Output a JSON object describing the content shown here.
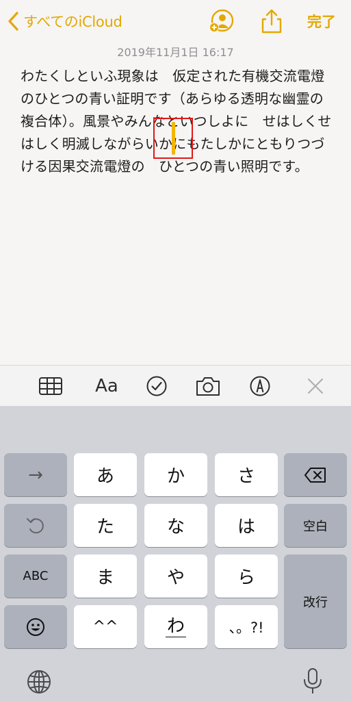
{
  "nav": {
    "back_label": "すべてのiCloud",
    "done_label": "完了"
  },
  "note": {
    "date": "2019年11月1日 16:17",
    "body": "わたくしといふ現象は　仮定された有機交流電燈のひとつの青い証明です（あらゆる透明な幽霊の複合体）。風景やみんなといつしよに　せはしくせはしく明滅しながらいかにもたしかにともりつづける因果交流電燈の　ひとつの青い照明です。"
  },
  "toolbar": {
    "aa_label": "Aa"
  },
  "keyboard": {
    "row1": [
      "あ",
      "か",
      "さ"
    ],
    "row2": [
      "た",
      "な",
      "は"
    ],
    "row3": [
      "ま",
      "や",
      "ら"
    ],
    "row4": [
      "^^",
      "わ",
      "、。?!"
    ],
    "left": {
      "arrow": "→",
      "abc": "ABC"
    },
    "right": {
      "space": "空白",
      "enter": "改行"
    }
  },
  "colors": {
    "accent": "#e3a800",
    "cursor": "#f2b705",
    "highlight_box": "#e01818"
  }
}
